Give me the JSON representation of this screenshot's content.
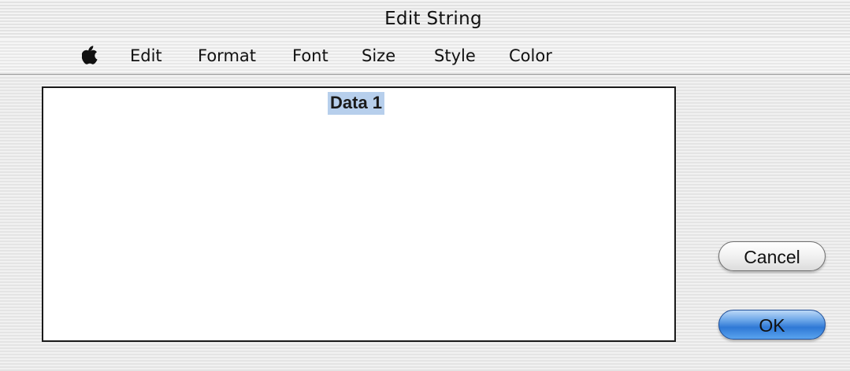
{
  "window": {
    "title": "Edit String"
  },
  "menu": {
    "apple_icon": "apple-logo",
    "items": [
      "Edit",
      "Format",
      "Font",
      "Size",
      "Style",
      "Color"
    ]
  },
  "editor": {
    "text": "Data 1",
    "selection_color": "#b7cfec"
  },
  "buttons": {
    "cancel": "Cancel",
    "ok": "OK"
  },
  "colors": {
    "default_button": "#2f79d6"
  }
}
